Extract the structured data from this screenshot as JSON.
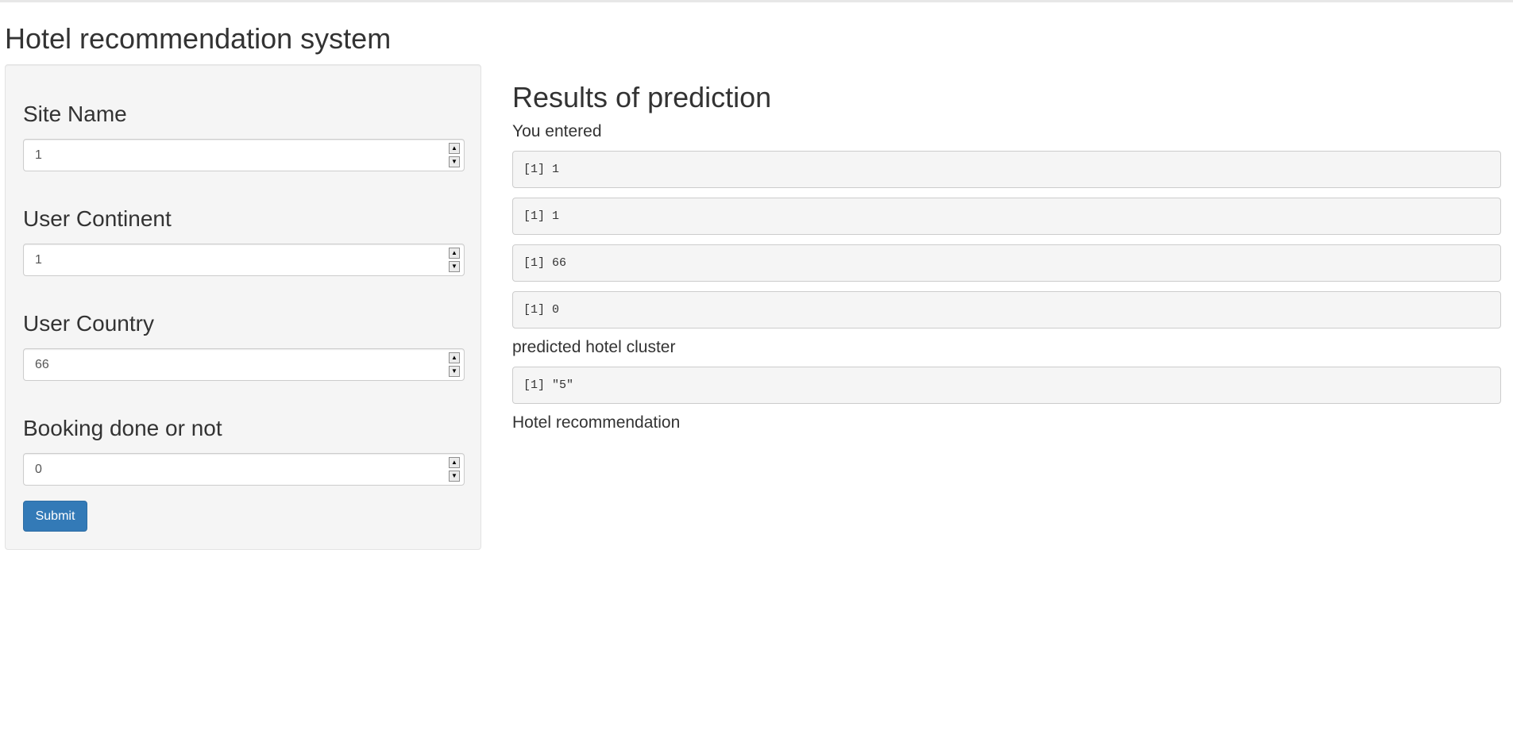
{
  "app": {
    "title": "Hotel recommendation system"
  },
  "sidebar": {
    "fields": [
      {
        "label": "Site Name",
        "value": "1"
      },
      {
        "label": "User Continent",
        "value": "1"
      },
      {
        "label": "User Country",
        "value": "66"
      },
      {
        "label": "Booking done or not",
        "value": "0"
      }
    ],
    "submit_label": "Submit"
  },
  "main": {
    "title": "Results of prediction",
    "entered_label": "You entered",
    "entered_outputs": [
      "[1] 1",
      "[1] 1",
      "[1] 66",
      "[1] 0"
    ],
    "cluster_label": "predicted hotel cluster",
    "cluster_output": "[1] \"5\"",
    "recommendation_label": "Hotel recommendation"
  },
  "icons": {
    "spinner_up": "spinner-up-icon",
    "spinner_down": "spinner-down-icon"
  },
  "colors": {
    "primary_button": "#337ab7",
    "panel_background": "#f5f5f5",
    "text": "#333333"
  }
}
